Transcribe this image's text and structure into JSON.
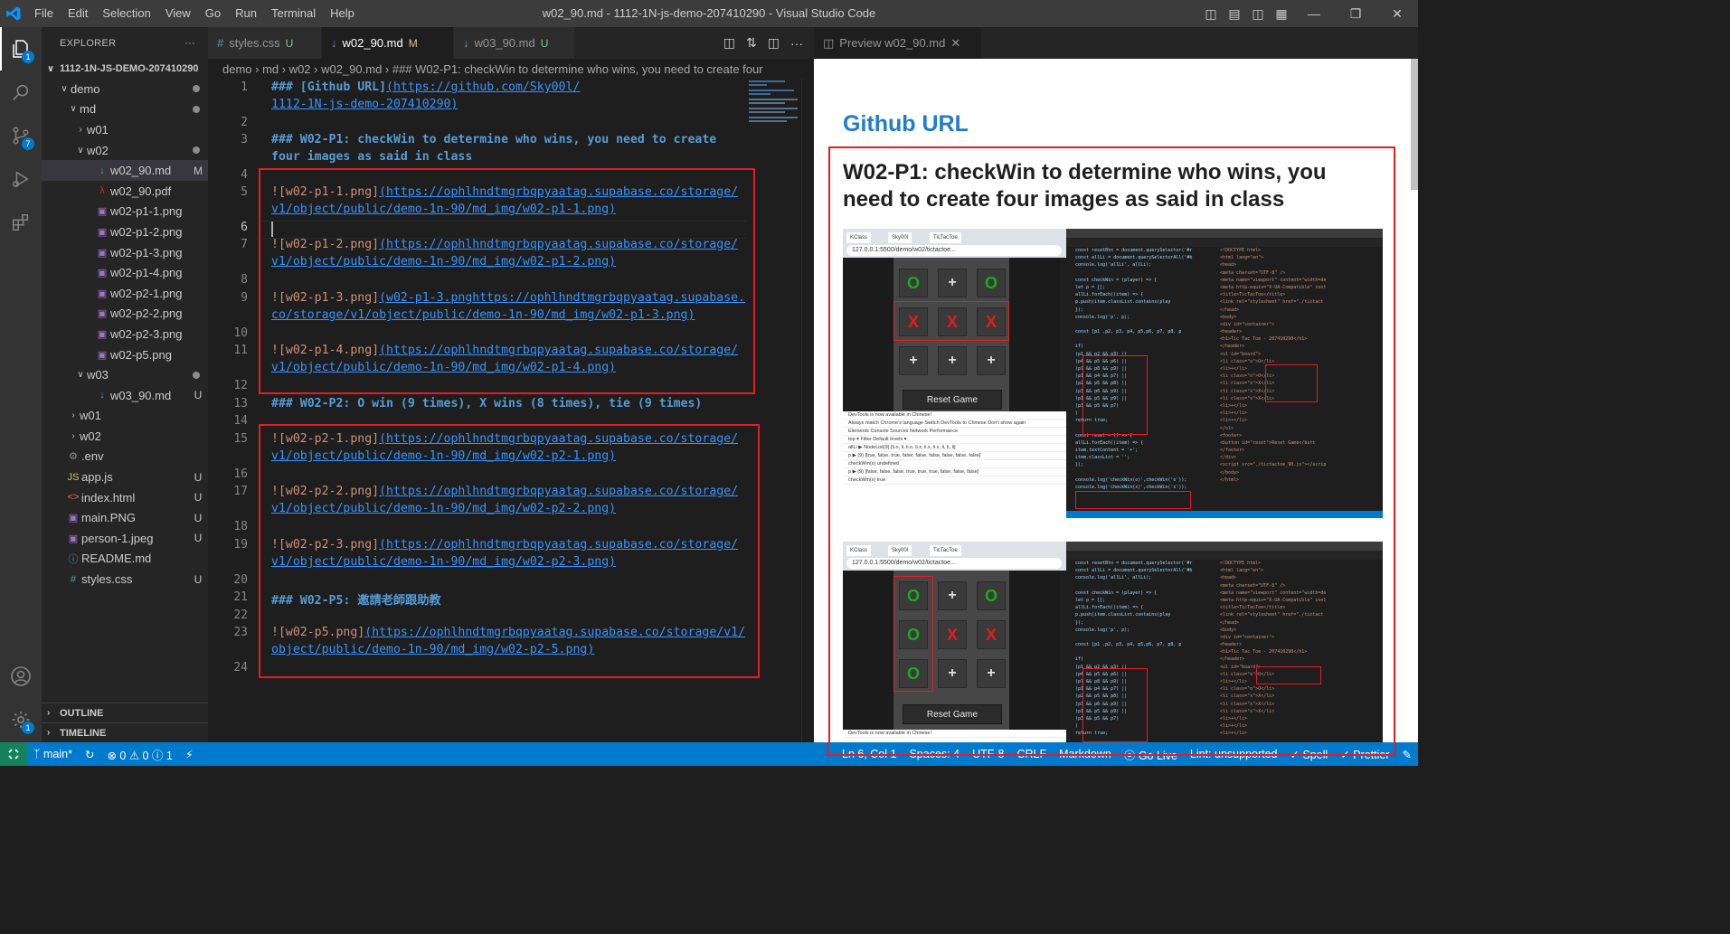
{
  "window": {
    "title": "w02_90.md - 1112-1N-js-demo-207410290 - Visual Studio Code",
    "menu": [
      "File",
      "Edit",
      "Selection",
      "View",
      "Go",
      "Run",
      "Terminal",
      "Help"
    ]
  },
  "activity_badges": {
    "explorer": "1",
    "source_control": "7",
    "accounts": "1"
  },
  "sidebar": {
    "header": "EXPLORER",
    "more": "···",
    "project": "1112-1N-JS-DEMO-207410290",
    "items": [
      {
        "label": "demo",
        "status": "",
        "dot": true
      },
      {
        "label": "md",
        "status": "",
        "dot": true
      },
      {
        "label": "w01",
        "status": ""
      },
      {
        "label": "w02",
        "status": "",
        "dot": true
      },
      {
        "label": "w02_90.md",
        "status": "M"
      },
      {
        "label": "w02_90.pdf",
        "status": ""
      },
      {
        "label": "w02-p1-1.png",
        "status": ""
      },
      {
        "label": "w02-p1-2.png",
        "status": ""
      },
      {
        "label": "w02-p1-3.png",
        "status": ""
      },
      {
        "label": "w02-p1-4.png",
        "status": ""
      },
      {
        "label": "w02-p2-1.png",
        "status": ""
      },
      {
        "label": "w02-p2-2.png",
        "status": ""
      },
      {
        "label": "w02-p2-3.png",
        "status": ""
      },
      {
        "label": "w02-p5.png",
        "status": ""
      },
      {
        "label": "w03",
        "status": "",
        "dot": true
      },
      {
        "label": "w03_90.md",
        "status": "U"
      },
      {
        "label": "w01",
        "status": ""
      },
      {
        "label": "w02",
        "status": ""
      },
      {
        "label": ".env",
        "status": ""
      },
      {
        "label": "app.js",
        "status": "U"
      },
      {
        "label": "index.html",
        "status": "U"
      },
      {
        "label": "main.PNG",
        "status": "U"
      },
      {
        "label": "person-1.jpeg",
        "status": "U"
      },
      {
        "label": "README.md",
        "status": ""
      },
      {
        "label": "styles.css",
        "status": "U"
      }
    ],
    "outline": "OUTLINE",
    "timeline": "TIMELINE"
  },
  "editor": {
    "tabs": [
      {
        "label": "styles.css",
        "status": "U"
      },
      {
        "label": "w02_90.md",
        "status": "M"
      },
      {
        "label": "w03_90.md",
        "status": "U"
      }
    ],
    "breadcrumb": "demo › md › w02 ›  w02_90.md ›  ### W02-P1: checkWin to determine who wins, you need to create four",
    "line_numbers": [
      "1",
      "2",
      "3",
      "4",
      "5",
      "6",
      "7",
      "8",
      "9",
      "10",
      "11",
      "12",
      "13",
      "14",
      "15",
      "16",
      "17",
      "18",
      "19",
      "20",
      "21",
      "22",
      "23",
      "24"
    ],
    "code": {
      "l1_head": "### ",
      "l1_text": "[Github URL]",
      "l1_url_a": "(https://github.com/Sky00l/",
      "l1_url_b": "1112-1N-js-demo-207410290)",
      "l3_a": "### W02-P1: checkWin to determine who wins, you need to create",
      "l3_b": "four images as said in class",
      "l5_alt": "![w02-p1-1.png]",
      "l5_url_a": "(https://ophlhndtmgrbqpyaatag.supabase.co/storage/",
      "l5_url_b": "v1/object/public/demo-1n-90/md_img/w02-p1-1.png)",
      "l7_alt": "![w02-p1-2.png]",
      "l7_url_a": "(https://ophlhndtmgrbqpyaatag.supabase.co/storage/",
      "l7_url_b": "v1/object/public/demo-1n-90/md_img/w02-p1-2.png)",
      "l9_alt": "![w02-p1-3.png]",
      "l9_url_a": "(w02-p1-3.pnghttps://ophlhndtmgrbqpyaatag.supabase.",
      "l9_url_b": "co/storage/v1/object/public/demo-1n-90/md_img/w02-p1-3.png)",
      "l11_alt": "![w02-p1-4.png]",
      "l11_url_a": "(https://ophlhndtmgrbqpyaatag.supabase.co/storage/",
      "l11_url_b": "v1/object/public/demo-1n-90/md_img/w02-p1-4.png)",
      "l13": "### W02-P2: O win (9 times), X wins (8 times), tie (9 times)",
      "l15_alt": "![w02-p2-1.png]",
      "l15_url_a": "(https://ophlhndtmgrbqpyaatag.supabase.co/storage/",
      "l15_url_b": "v1/object/public/demo-1n-90/md_img/w02-p2-1.png)",
      "l17_alt": "![w02-p2-2.png]",
      "l17_url_a": "(https://ophlhndtmgrbqpyaatag.supabase.co/storage/",
      "l17_url_b": "v1/object/public/demo-1n-90/md_img/w02-p2-2.png)",
      "l19_alt": "![w02-p2-3.png]",
      "l19_url_a": "(https://ophlhndtmgrbqpyaatag.supabase.co/storage/",
      "l19_url_b": "v1/object/public/demo-1n-90/md_img/w02-p2-3.png)",
      "l21": "### W02-P5: 邀請老師跟助教",
      "l23_alt": "![w02-p5.png]",
      "l23_url_a": "(https://ophlhndtmgrbqpyaatag.supabase.co/storage/v1/",
      "l23_url_b": "object/public/demo-1n-90/md_img/w02-p2-5.png)"
    }
  },
  "preview": {
    "tab": "Preview w02_90.md",
    "h1": "Github URL",
    "h2": "W02-P1: checkWin to determine who wins, you need to create four images as said in class",
    "shot1": {
      "url": "127.0.0.1:5500/demo/w02/tictactoe...",
      "browser_tabs": [
        "KClass",
        "Sky00l",
        "TicTacToe"
      ],
      "board": [
        "o",
        "p",
        "o",
        "x",
        "x",
        "x",
        "p",
        "p",
        "p"
      ],
      "reset": "Reset Game",
      "devtools": [
        "DevTools is now available in Chinese!",
        "Always match Chrome's language   Switch DevTools to Chinese   Don't show again",
        "Elements   Console   Sources   Network   Performance",
        "top  ▾   Filter                                  Default levels ▾",
        "allLi ▶ NodeList(9) [li.o, li, li.o, li.x, li.x, li.x, li, li, li]",
        "p ▶ (9) [true, false, true, false, false, false, false, false, false]",
        "checkWin(x) undefined",
        "p ▶ (9) [false, false, false, true, true, true, false, false, false]",
        "checkWin(x) true"
      ]
    },
    "shot2": {
      "url": "127.0.0.1:5500/demo/w02/tictactoe...",
      "browser_tabs": [
        "KClass",
        "Sky00l",
        "TicTacToe"
      ],
      "board": [
        "o",
        "p",
        "o",
        "o",
        "x",
        "x",
        "o",
        "p",
        "p"
      ],
      "reset": "Reset Game",
      "devtools": [
        "DevTools is now available in Chinese!"
      ]
    },
    "code_lines": [
      "const resetBtn = document.querySelector('#r",
      "const allLi = document.querySelectorAll('#b",
      "console.log('allLi', allLi);",
      "",
      "const checkWin = (player) => {",
      "  let p = [];",
      "  allLi.forEach((item) => {",
      "    p.push(item.classList.contains(play",
      "  });",
      "  console.log('p', p);",
      "",
      "  const [p1 ,p2, p3, p4, p5,p6, p7, p8, p",
      "",
      "  if(",
      "   (p1 && p2 && p3) ||",
      "   (p4 && p5 && p6) ||",
      "   (p7 && p8 && p9) ||",
      "   (p1 && p4 && p7) ||",
      "   (p2 && p5 && p8) ||",
      "   (p3 && p6 && p9) ||",
      "   (p1 && p5 && p9) ||",
      "   (p3 && p5 && p7)",
      "  )",
      "  return true;",
      "",
      "const reset = () => {",
      "  allLi.forEach((item) => {",
      "    item.textContent = '+';",
      "    item.classList = '';",
      "  });",
      "",
      "console.log('checkWin(o)',checkWin('o'));",
      "console.log('checkWin(x)',checkWin('x'));"
    ],
    "html_lines": [
      "<!DOCTYPE html>",
      "<html lang=\"en\">",
      "<head>",
      "  <meta charset=\"UTF-8\" />",
      "  <meta name=\"viewport\" content=\"width=de",
      "  <meta http-equiv=\"X-UA-Compatible\" cont",
      "  <title>TicTacToe</title>",
      "  <link rel=\"stylesheet\" href=\"./tictact",
      "</head>",
      "<body>",
      "  <div id=\"container\">",
      "    <header>",
      "      <h1>Tic Tac Toe - 207410290</h1>",
      "    </header>",
      "    <ul id=\"board\">",
      "      <li class=\"o\">O</li>",
      "      <li>+</li>",
      "      <li class=\"o\">O</li>",
      "      <li class=\"x\">X</li>",
      "      <li class=\"x\">X</li>",
      "      <li class=\"x\">X</li>",
      "      <li>+</li>",
      "      <li>+</li>",
      "      <li>+</li>",
      "    </ul>",
      "    <footer>",
      "      <button id=\"reset\">Reset Game</butt",
      "    </footer>",
      "  </div>",
      "  <script src=\"./tictactoe_90.js\"></scrip",
      "</body>",
      "</html>"
    ]
  },
  "statusbar": {
    "branch": "main*",
    "sync": "↻",
    "problems": "⊗ 0 ⚠ 0 ⓘ 1",
    "position": "Ln 6, Col 1",
    "spaces": "Spaces: 4",
    "encoding": "UTF-8",
    "eol": "CRLF",
    "language": "Markdown",
    "golive": "Go Live",
    "lint": "Lint: unsupported",
    "spell": "✓ Spell",
    "prettier": "✓ Prettier"
  }
}
